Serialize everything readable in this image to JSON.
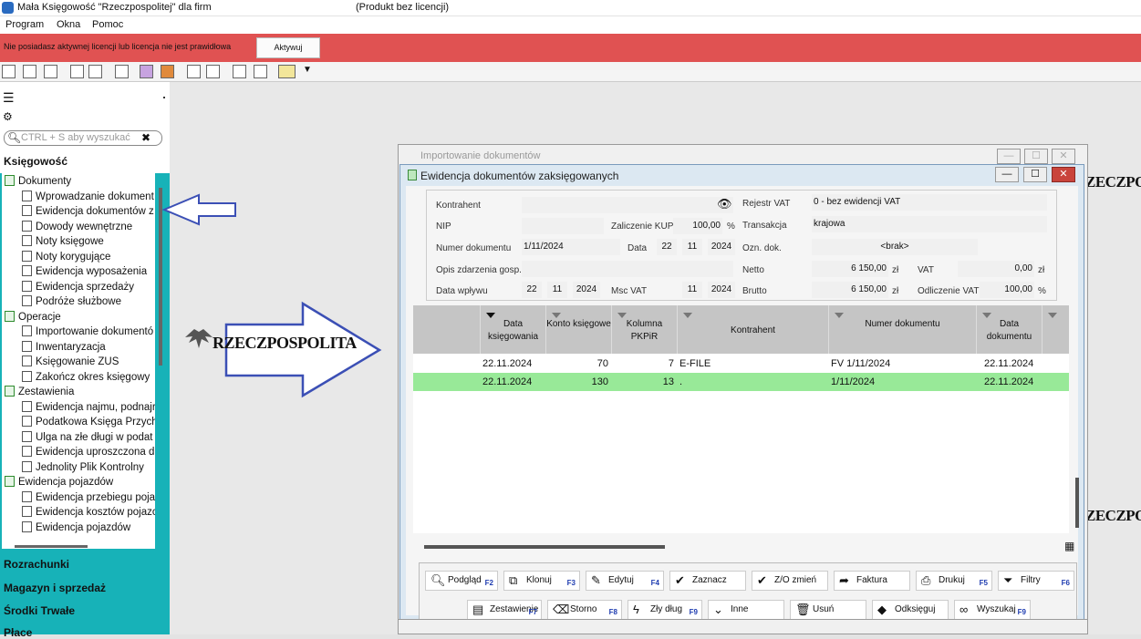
{
  "titlebar": {
    "app_title": "Mała Księgowość \"Rzeczpospolitej\" dla firm",
    "license_note": "(Produkt bez licencji)"
  },
  "menu": {
    "items": [
      "Program",
      "Okna",
      "Pomoc"
    ]
  },
  "license_bar": {
    "message": "Nie posiadasz aktywnej licencji lub licencja nie jest prawidłowa",
    "activate_label": "Aktywuj",
    "color": "#e05252"
  },
  "sidebar": {
    "search_placeholder": "CTRL + S aby wyszukać",
    "section_title": "Księgowość",
    "tree": [
      {
        "label": "Dokumenty",
        "group": true
      },
      {
        "label": "Wprowadzanie dokument",
        "group": false
      },
      {
        "label": "Ewidencja dokumentów z",
        "group": false
      },
      {
        "label": "Dowody wewnętrzne",
        "group": false
      },
      {
        "label": "Noty księgowe",
        "group": false
      },
      {
        "label": "Noty korygujące",
        "group": false
      },
      {
        "label": "Ewidencja wyposażenia",
        "group": false
      },
      {
        "label": "Ewidencja sprzedaży",
        "group": false
      },
      {
        "label": "Podróże służbowe",
        "group": false
      },
      {
        "label": "Operacje",
        "group": true
      },
      {
        "label": "Importowanie dokumentó",
        "group": false
      },
      {
        "label": "Inwentaryzacja",
        "group": false
      },
      {
        "label": "Księgowanie ZUS",
        "group": false
      },
      {
        "label": "Zakończ okres księgowy",
        "group": false
      },
      {
        "label": "Zestawienia",
        "group": true
      },
      {
        "label": "Ewidencja najmu, podnajr",
        "group": false
      },
      {
        "label": "Podatkowa Księga Przych",
        "group": false
      },
      {
        "label": "Ulga na złe długi w podat",
        "group": false
      },
      {
        "label": "Ewidencja uproszczona dl",
        "group": false
      },
      {
        "label": "Jednolity Plik Kontrolny",
        "group": false
      },
      {
        "label": "Ewidencja pojazdów",
        "group": true
      },
      {
        "label": "Ewidencja przebiegu poja",
        "group": false
      },
      {
        "label": "Ewidencja kosztów pojazc",
        "group": false
      },
      {
        "label": "Ewidencja pojazdów",
        "group": false
      }
    ],
    "sections": [
      "Rozrachunki",
      "Magazyn i sprzedaż",
      "Środki Trwałe",
      "Płace"
    ],
    "accent": "#17b2b8"
  },
  "logo": {
    "text": "RZECZPOSPOLITA",
    "text_right": "ZECZPO",
    "text_right2": "ZECZPOS"
  },
  "back_window": {
    "title": "Importowanie dokumentów"
  },
  "window": {
    "title": "Ewidencja dokumentów zaksięgowanych",
    "form": {
      "kontrahent_label": "Kontrahent",
      "nip_label": "NIP",
      "zaliczenie_label": "Zaliczenie KUP",
      "zaliczenie_value": "100,00",
      "percent": "%",
      "numer_label": "Numer dokumentu",
      "numer_value": "1/11/2024",
      "data_label": "Data",
      "data_d": "22",
      "data_m": "11",
      "data_y": "2024",
      "opis_label": "Opis zdarzenia gosp.",
      "data_wplywu_label": "Data wpływu",
      "wplyw_d": "22",
      "wplyw_m": "11",
      "wplyw_y": "2024",
      "msc_vat_label": "Msc VAT",
      "msc_m": "11",
      "msc_y": "2024",
      "rejestr_label": "Rejestr VAT",
      "rejestr_value": "0 - bez ewidencji VAT",
      "transakcja_label": "Transakcja",
      "transakcja_value": "krajowa",
      "ozn_label": "Ozn. dok.",
      "ozn_value": "<brak>",
      "netto_label": "Netto",
      "netto_value": "6 150,00",
      "zl": "zł",
      "vat_label": "VAT",
      "vat_value": "0,00",
      "brutto_label": "Brutto",
      "brutto_value": "6 150,00",
      "odliczenie_label": "Odliczenie VAT",
      "odliczenie_value": "100,00"
    },
    "grid": {
      "columns": [
        "Data księgowania",
        "Konto księgowe",
        "Kolumna PKPiR",
        "Kontrahent",
        "Numer dokumentu",
        "Data dokumentu"
      ],
      "rows": [
        {
          "data": "22.11.2024",
          "konto": "70",
          "kolumna": "7",
          "kontrahent": "E-FILE",
          "numer": "FV 1/11/2024",
          "data_dok": "22.11.2024",
          "selected": false
        },
        {
          "data": "22.11.2024",
          "konto": "130",
          "kolumna": "13",
          "kontrahent": ".",
          "numer": "1/11/2024",
          "data_dok": "22.11.2024",
          "selected": true
        }
      ],
      "selected_color": "#98e998"
    },
    "buttons_row1": [
      {
        "label": "Podgląd",
        "key": "F2",
        "icon": "magnifier-icon"
      },
      {
        "label": "Klonuj",
        "key": "F3",
        "icon": "copy-icon"
      },
      {
        "label": "Edytuj",
        "key": "F4",
        "icon": "pencil-icon"
      },
      {
        "label": "Zaznacz",
        "key": "",
        "icon": "check-icon"
      },
      {
        "label": "Z/O zmień",
        "key": "",
        "icon": "check-icon"
      },
      {
        "label": "Faktura",
        "key": "",
        "icon": "arrow-icon"
      },
      {
        "label": "Drukuj",
        "key": "F5",
        "icon": "printer-icon"
      },
      {
        "label": "Filtry",
        "key": "F6",
        "icon": "filter-icon"
      }
    ],
    "buttons_row2": [
      {
        "label": "Zestawienie",
        "key": "F7",
        "icon": "book-icon"
      },
      {
        "label": "Storno",
        "key": "F8",
        "icon": "eraser-icon"
      },
      {
        "label": "Zły dług",
        "key": "F9",
        "icon": "bolt-icon"
      },
      {
        "label": "Inne",
        "key": "",
        "icon": "chevron-down-icon"
      },
      {
        "label": "Usuń",
        "key": "",
        "icon": "trash-icon"
      },
      {
        "label": "Odksięguj",
        "key": "",
        "icon": "tag-icon"
      },
      {
        "label": "Wyszukaj",
        "key": "F9",
        "icon": "binoculars-icon"
      }
    ]
  }
}
